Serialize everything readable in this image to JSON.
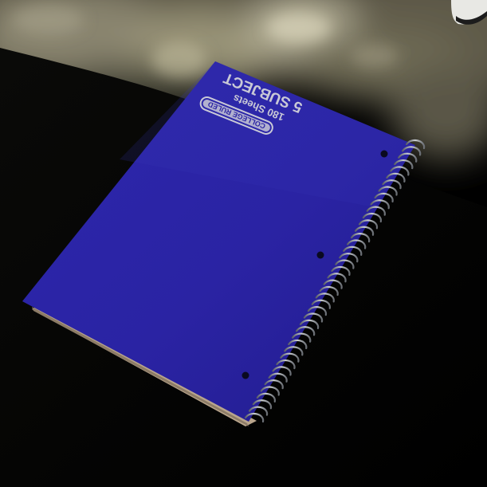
{
  "notebook": {
    "badge_text": "COLLEGE RULED",
    "subject_text": "5 SUBJECT",
    "sheets_text": "180 Sheets",
    "cover_color": "#2a23a3",
    "text_color": "#c9c9d6"
  }
}
